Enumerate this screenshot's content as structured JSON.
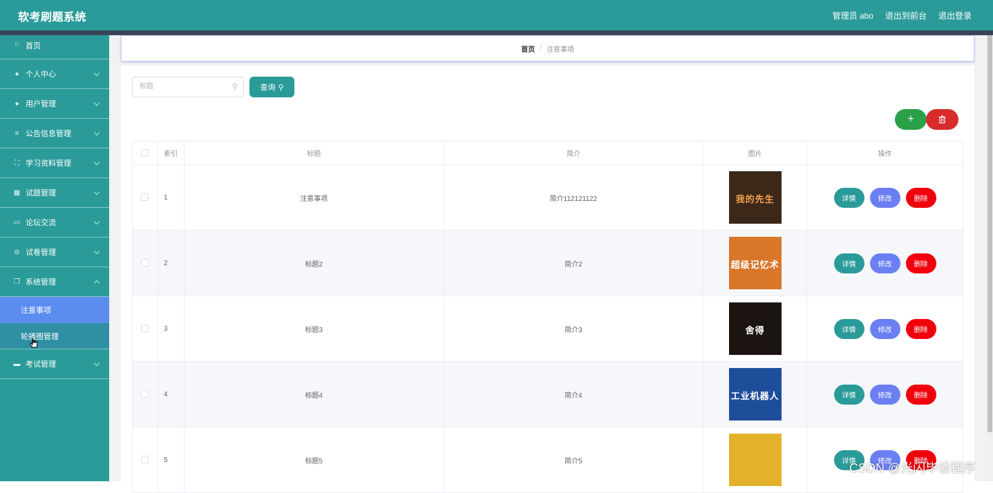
{
  "header": {
    "app_title": "软考刷题系统",
    "admin_label": "管理员 abo",
    "back_front": "退出到前台",
    "logout": "退出登录"
  },
  "sidebar": {
    "items": [
      {
        "label": "首页",
        "icon": "home-icon",
        "chevron": false
      },
      {
        "label": "个人中心",
        "icon": "user-icon",
        "chevron": true
      },
      {
        "label": "用户管理",
        "icon": "user-icon",
        "chevron": true
      },
      {
        "label": "公告信息管理",
        "icon": "list-icon",
        "chevron": true
      },
      {
        "label": "学习资料管理",
        "icon": "frame-icon",
        "chevron": true
      },
      {
        "label": "试题管理",
        "icon": "grid-icon",
        "chevron": true
      },
      {
        "label": "论坛交流",
        "icon": "chat-icon",
        "chevron": true
      },
      {
        "label": "试卷管理",
        "icon": "compass-icon",
        "chevron": true
      },
      {
        "label": "系统管理",
        "icon": "copy-icon",
        "chevron": true,
        "expanded": true
      }
    ],
    "submenu": [
      {
        "label": "注意事项",
        "active": true
      },
      {
        "label": "轮播图管理",
        "active": false
      }
    ],
    "after": [
      {
        "label": "考试管理",
        "icon": "ticket-icon",
        "chevron": true
      }
    ]
  },
  "breadcrumb": {
    "home": "首页",
    "separator": "/",
    "current": "注意事项"
  },
  "search": {
    "placeholder": "标题",
    "button_label": "查询"
  },
  "actions": {
    "add_symbol": "+",
    "delete_icon": "trash-icon"
  },
  "table": {
    "headers": [
      "索引",
      "标题",
      "简介",
      "图片",
      "操作"
    ],
    "rows": [
      {
        "index": "1",
        "title": "注意事项",
        "intro": "简介112121122",
        "cover_text": "我的先生",
        "cover_bg": "#3b2818",
        "cover_fg": "#f2a24b"
      },
      {
        "index": "2",
        "title": "标题2",
        "intro": "简介2",
        "cover_text": "超级记忆术",
        "cover_bg": "#d8762a",
        "cover_fg": "#ffffff"
      },
      {
        "index": "3",
        "title": "标题3",
        "intro": "简介3",
        "cover_text": "舍得",
        "cover_bg": "#1b1410",
        "cover_fg": "#ffffff"
      },
      {
        "index": "4",
        "title": "标题4",
        "intro": "简介4",
        "cover_text": "工业机器人",
        "cover_bg": "#1e4d9a",
        "cover_fg": "#ffffff"
      },
      {
        "index": "5",
        "title": "标题5",
        "intro": "简介5",
        "cover_text": "",
        "cover_bg": "#e4b22a",
        "cover_fg": "#7a4a10"
      }
    ],
    "ops": {
      "detail": "详情",
      "edit": "修改",
      "remove": "删除"
    }
  },
  "watermark": "CSDN @光闪毕设程序",
  "colors": {
    "primary": "#2a9b99",
    "active_sub": "#5b8def",
    "danger": "#f0000c",
    "edit": "#6b7ff3",
    "success": "#2aa148"
  }
}
